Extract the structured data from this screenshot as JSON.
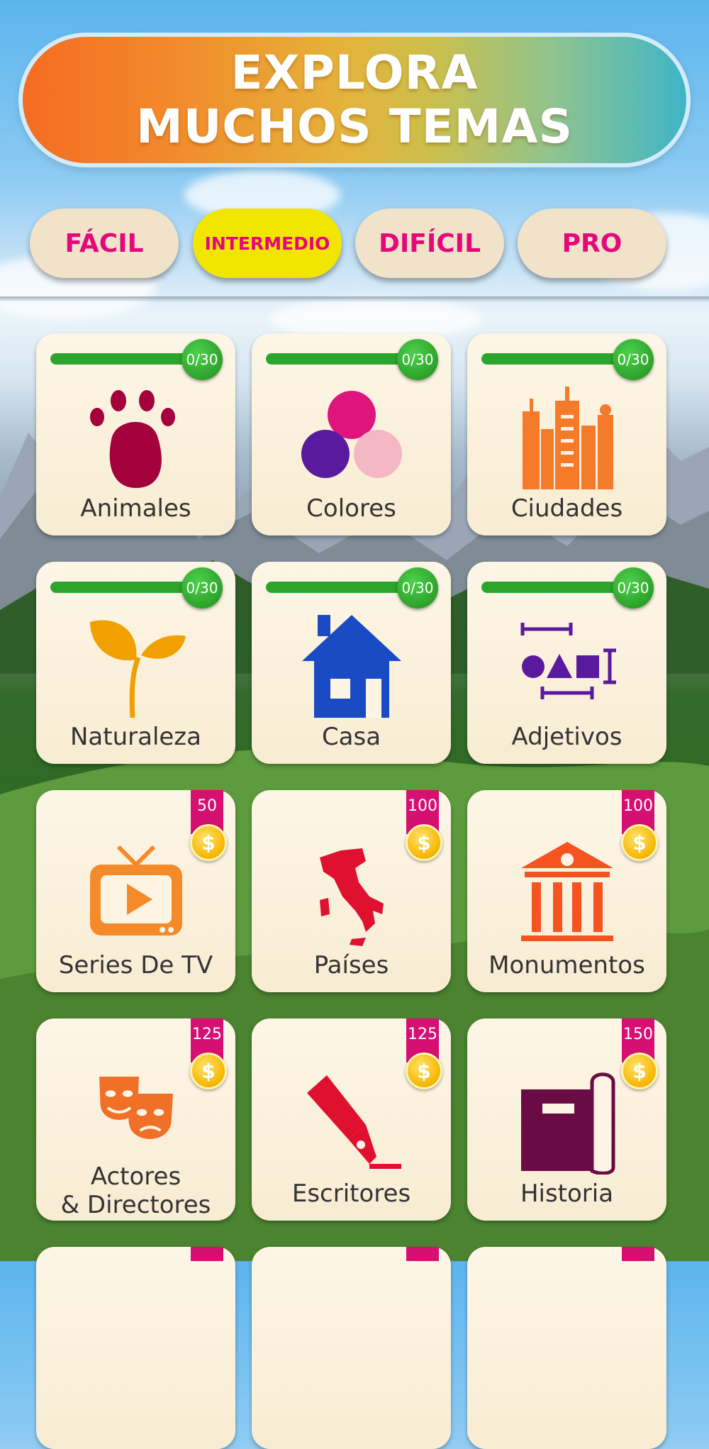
{
  "banner": {
    "title": "EXPLORA MUCHOS TEMAS"
  },
  "tabs": [
    {
      "label": "FÁCIL",
      "active": false
    },
    {
      "label": "INTERMEDIO",
      "active": true
    },
    {
      "label": "DIFÍCIL",
      "active": false
    },
    {
      "label": "PRO",
      "active": false
    }
  ],
  "colors": {
    "accent": "#e6077a",
    "active_tab": "#f2e500",
    "progress": "#2ba52c",
    "ribbon": "#d60f72",
    "coin": "#f5b500"
  },
  "categories": [
    {
      "label": "Animales",
      "icon": "paw-icon",
      "progress_text": "0/30",
      "progress": 0
    },
    {
      "label": "Colores",
      "icon": "color-circles-icon",
      "progress_text": "0/30",
      "progress": 0
    },
    {
      "label": "Ciudades",
      "icon": "city-buildings-icon",
      "progress_text": "0/30",
      "progress": 0
    },
    {
      "label": "Naturaleza",
      "icon": "plant-sprout-icon",
      "progress_text": "0/30",
      "progress": 0
    },
    {
      "label": "Casa",
      "icon": "house-icon",
      "progress_text": "0/30",
      "progress": 0
    },
    {
      "label": "Adjetivos",
      "icon": "shapes-measure-icon",
      "progress_text": "0/30",
      "progress": 0
    },
    {
      "label": "Series De TV",
      "icon": "tv-icon",
      "price": "50",
      "coin_symbol": "$"
    },
    {
      "label": "Países",
      "icon": "italy-map-icon",
      "price": "100",
      "coin_symbol": "$"
    },
    {
      "label": "Monumentos",
      "icon": "monument-icon",
      "price": "100",
      "coin_symbol": "$"
    },
    {
      "label": "Actores\n& Directores",
      "icon": "theater-masks-icon",
      "price": "125",
      "coin_symbol": "$"
    },
    {
      "label": "Escritores",
      "icon": "fountain-pen-icon",
      "price": "125",
      "coin_symbol": "$"
    },
    {
      "label": "Historia",
      "icon": "history-book-icon",
      "price": "150",
      "coin_symbol": "$"
    }
  ]
}
